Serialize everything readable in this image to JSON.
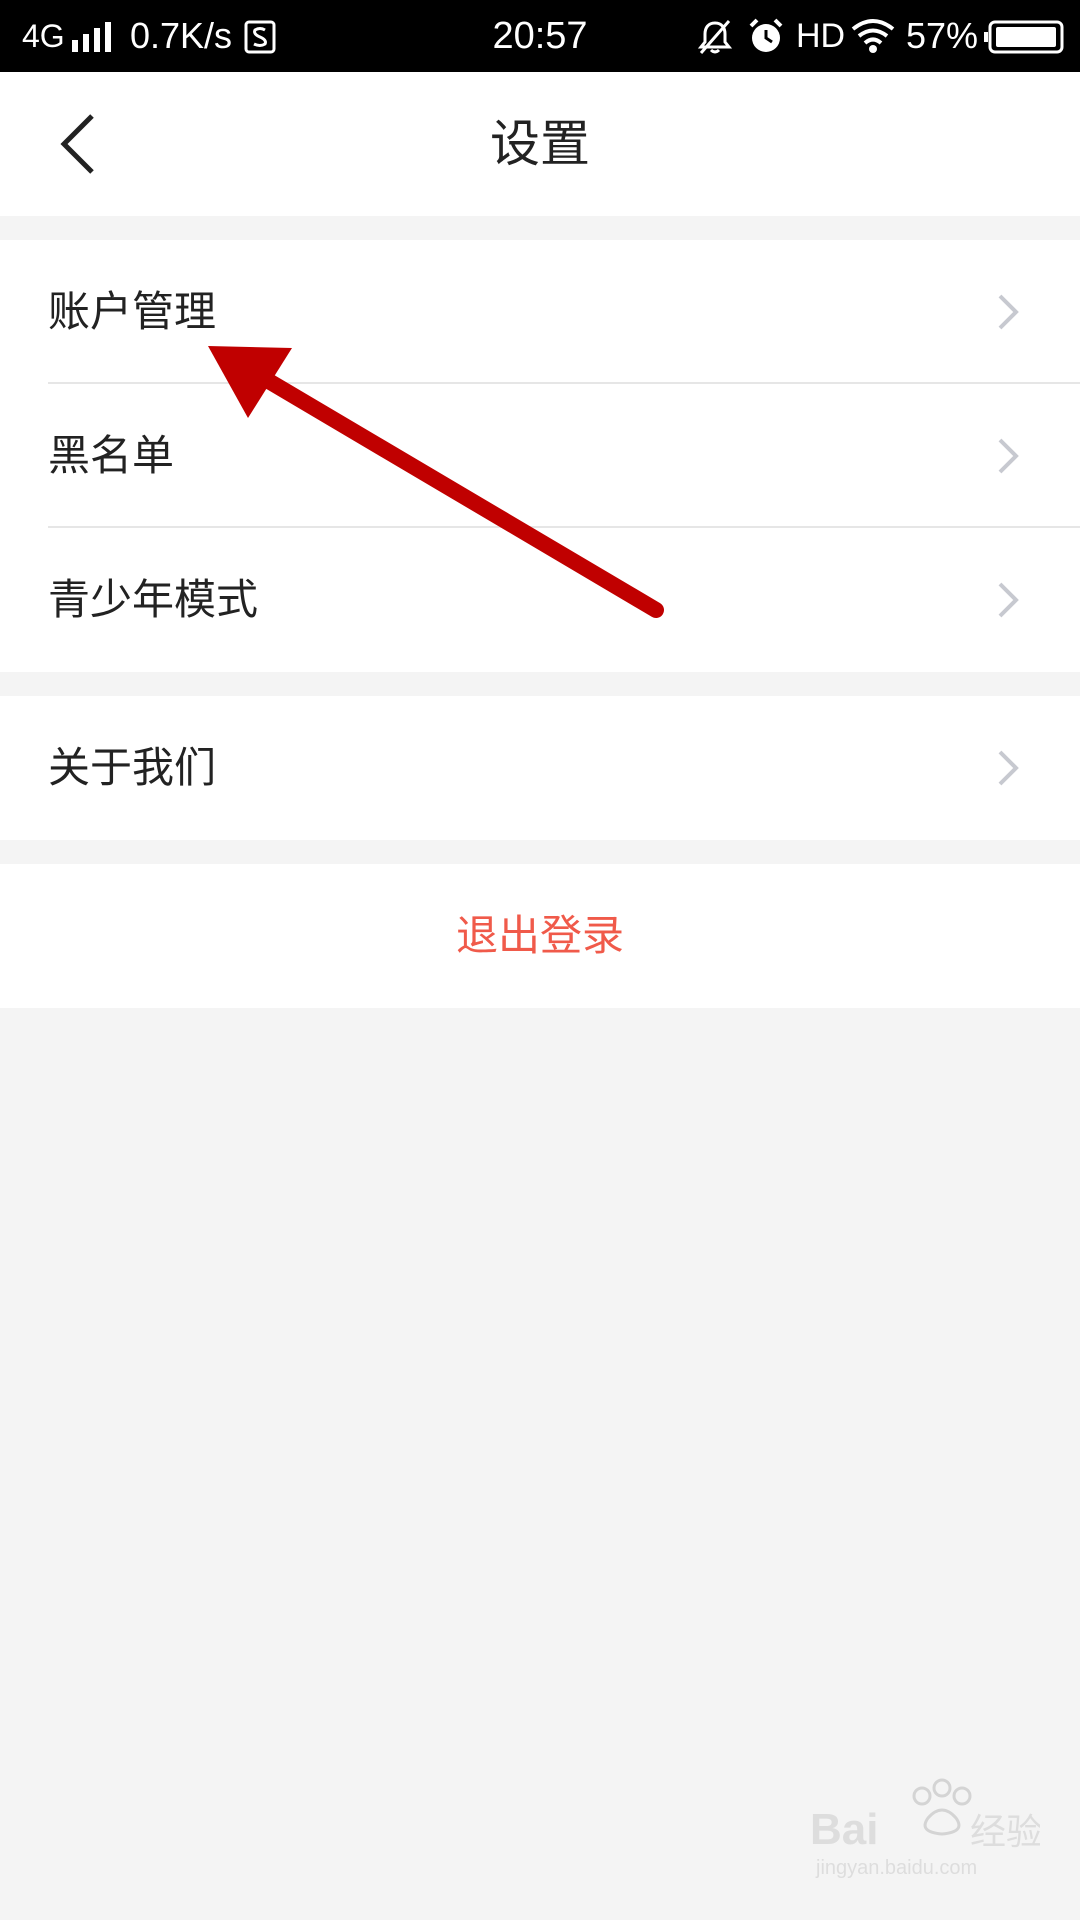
{
  "status_bar": {
    "network": "4G",
    "speed": "0.7K/s",
    "time": "20:57",
    "hd": "HD",
    "battery": "57%"
  },
  "header": {
    "title": "设置"
  },
  "groups": [
    {
      "items": [
        {
          "label": "账户管理"
        },
        {
          "label": "黑名单"
        },
        {
          "label": "青少年模式"
        }
      ]
    },
    {
      "items": [
        {
          "label": "关于我们"
        }
      ]
    }
  ],
  "logout": {
    "label": "退出登录"
  },
  "colors": {
    "accent": "#f05a4a",
    "annotation_arrow": "#c00000"
  },
  "icons": {
    "back": "chevron-left-icon",
    "row": "chevron-right-icon"
  }
}
